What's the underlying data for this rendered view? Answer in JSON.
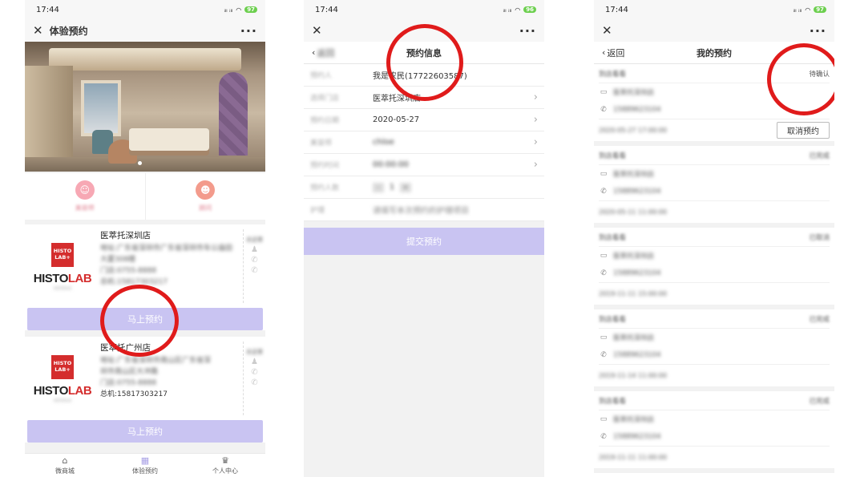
{
  "status": {
    "time": "17:44",
    "battery_1": "97",
    "battery_2": "96",
    "battery_3": "97",
    "signal": "ᵢₗₗ ᵢₗₗ"
  },
  "colors": {
    "accent": "#c9c4f2",
    "highlight_circle": "#e01b1b",
    "logo_red": "#d42d2d"
  },
  "phone1": {
    "title": "体验预约",
    "icons": [
      {
        "icon": "beautician-icon",
        "label": "美容师"
      },
      {
        "icon": "consultant-icon",
        "label": "顾问"
      }
    ],
    "stores": [
      {
        "name": "医萃托深圳店",
        "address": "地址:广东省深圳市广东省深圳市车公庙田大厦308楼",
        "address_line2": "",
        "phone": "门店:0755-8888",
        "hotline": "总机:15817303217",
        "side_label": "去这里",
        "book": "马上预约"
      },
      {
        "name": "医萃托广州店",
        "address": "地址:广东省深圳市南山区广东省深",
        "address_line2": "圳市南山区大冲路",
        "phone": "门店:0755-8888",
        "hotline": "总机:15817303217",
        "side_label": "去这里",
        "book": "马上预约"
      }
    ],
    "logo": {
      "box_line1": "HISTO",
      "box_line2": "LAB+",
      "text_a": "HISTO",
      "text_b": "LAB",
      "sub": "HISTOPLUS"
    },
    "tabs": [
      {
        "icon": "house-icon",
        "label": "微商城"
      },
      {
        "icon": "calendar-icon",
        "label": "体验预约"
      },
      {
        "icon": "crown-icon",
        "label": "个人中心"
      }
    ]
  },
  "phone2": {
    "back": "返回",
    "title": "预约信息",
    "rows": [
      {
        "label": "预约人",
        "value": "我是农民(17722603587)"
      },
      {
        "label": "选择门店",
        "value": "医萃托深圳店"
      },
      {
        "label": "预约日期",
        "value": "2020-05-27"
      },
      {
        "label": "美容师",
        "value": "chloe"
      },
      {
        "label": "预约时间",
        "value": "00:00:00"
      },
      {
        "label": "预约人数",
        "value": "1"
      },
      {
        "label": "护理",
        "value": "请填写本次预约的护理项目"
      }
    ],
    "stepper_minus": "-",
    "stepper_plus": "+",
    "submit": "提交预约"
  },
  "phone3": {
    "back": "返回",
    "title": "我的预约",
    "items": [
      {
        "label": "到店看看",
        "status": "待确认",
        "store": "医萃托深圳店",
        "phone": "15889623104",
        "datetime": "2020-05-27 17:00:00",
        "action": "取消预约"
      },
      {
        "label": "到店看看",
        "status": "已完成",
        "store": "医萃托深圳店",
        "phone": "15889623104",
        "datetime": "2020-05-11 11:00:00",
        "action": ""
      },
      {
        "label": "到店看看",
        "status": "已取消",
        "store": "医萃托深圳店",
        "phone": "15889623104",
        "datetime": "2019-11-11 15:00:00",
        "action": ""
      },
      {
        "label": "到店看看",
        "status": "已完成",
        "store": "医萃托深圳店",
        "phone": "15889623104",
        "datetime": "2019-11-14 11:00:00",
        "action": ""
      },
      {
        "label": "到店看看",
        "status": "已完成",
        "store": "医萃托深圳店",
        "phone": "15889623104",
        "datetime": "2019-11-11 11:00:00",
        "action": ""
      }
    ]
  }
}
